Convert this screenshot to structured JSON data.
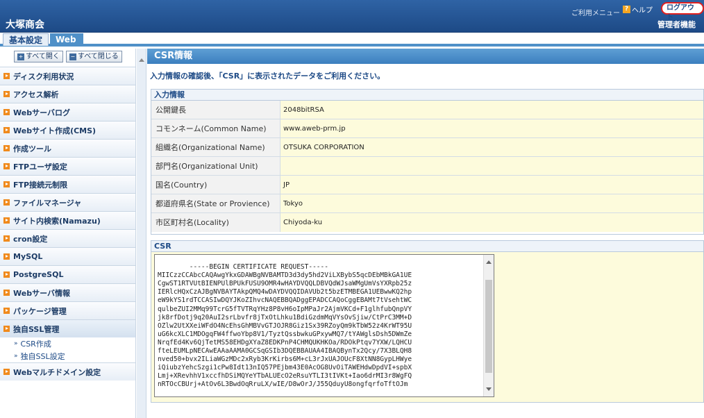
{
  "header": {
    "app_title": "大塚商会",
    "menu_label": "ご利用メニュー",
    "help_label": "ヘルプ",
    "logout_label": "ログアウト",
    "admin_label": "管理者機能"
  },
  "tabs": [
    {
      "label": "基本設定"
    },
    {
      "label": "Web"
    }
  ],
  "sidebar": {
    "expand_all": "すべて開く",
    "collapse_all": "すべて閉じる",
    "items": [
      {
        "label": "ディスク利用状況"
      },
      {
        "label": "アクセス解析"
      },
      {
        "label": "Webサーバログ"
      },
      {
        "label": "Webサイト作成(CMS)"
      },
      {
        "label": "作成ツール"
      },
      {
        "label": "FTPユーザ設定"
      },
      {
        "label": "FTP接続元制限"
      },
      {
        "label": "ファイルマネージャ"
      },
      {
        "label": "サイト内検索(Namazu)"
      },
      {
        "label": "cron設定"
      },
      {
        "label": "MySQL"
      },
      {
        "label": "PostgreSQL"
      },
      {
        "label": "Webサーバ情報"
      },
      {
        "label": "パッケージ管理"
      },
      {
        "label": "独自SSL管理"
      }
    ],
    "subitems": [
      {
        "label": "CSR作成"
      },
      {
        "label": "独自SSL設定"
      }
    ],
    "last_item": "Webマルチドメイン設定"
  },
  "main": {
    "title": "CSR情報",
    "instruction": "入力情報の確認後、「CSR」に表示されたデータをご利用ください。",
    "input_section": "入力情報",
    "rows": [
      {
        "label": "公開鍵長",
        "value": "2048bitRSA"
      },
      {
        "label": "コモンネーム(Common Name)",
        "value": "www.aweb-prm.jp"
      },
      {
        "label": "組織名(Organizational Name)",
        "value": "OTSUKA CORPORATION"
      },
      {
        "label": "部門名(Organizational Unit)",
        "value": ""
      },
      {
        "label": "国名(Country)",
        "value": "JP"
      },
      {
        "label": "都道府県名(State or Provience)",
        "value": "Tokyo"
      },
      {
        "label": "市区町村名(Locality)",
        "value": "Chiyoda-ku"
      }
    ],
    "csr_section": "CSR",
    "csr_text": "-----BEGIN CERTIFICATE REQUEST-----\nMIICzzCCAbcCAQAwgYkxGDAWBgNVBAMTD3d3dy5hd2ViLXBybS5qcDEbMBkGA1UE\nCgwST1RTVUtBIENPUlBPUkFUSU9OMR4wHAYDVQQLDBVQdWJsaWMgUmVsYXRpb25z\nIERlcHQxCzAJBgNVBAYTAkpQMQ4wDAYDVQQIDAVUb2t5bzETMBEGA1UEBwwKQ2hp\neW9kYS1rdTCCASIwDQYJKoZIhvcNAQEBBQADggEPADCCAQoCggEBAMt7tVsehtWC\nqulbeZUI2MMq99TcrG5fTVTRqYHz8P8vH6oIpMPaJr2AjmVKCd+F1glhfubQnpVY\njk8rfDotj9q20AuI2srLbvfr8jTxOtLhku1BdiGzdmMqVYsOvSjiw/CtPrC3MM+D\nOZlw2UtXXeiWFdO4NcEhsGhMBVvGTJOJR8Giz1Sx39RZoyQm9kTbW52z4KrWT95U\nuG6kcXLC1MDOgqFW4ffwoYbp8V1/TyztQssbwkuGPxywMQ7/tYAWglsDsh5DWmZe\nNrqfEd4Kv6QjTetMS58EHDgXYaZ8EDKPnP4CHMQUKHKOa/RDOkPtqv7YXW/LQHCU\nfteLEUMLpNECAwEAAaAAMA0GCSqGSIb3DQEBBAUAA4IBAQBynTx2Qcy/7X3BLQH8\nnved50+bvx2ILiaWGzMDc2xRyb3KrKirbs6M+cL3rJxUAJOUcF8XtNN8GypLHWye\niQiubzYehcSzgi1cPw8Idt13nIQ57PEjbm43E0AcOG8UvOiTAWEHdwDpdVI+spbX\nLmj+XRevhhV1xccfhDSiMQYeYTbALUEcO2eRsuYTLI3tIVKt+Iao6drMI3r8WgFQ\nnRTOcCBUrj+AtOv6L3BwdOqRruLX/wIE/D8wOrJ/J55QduyU8ongfqrfoTftOJm"
  }
}
